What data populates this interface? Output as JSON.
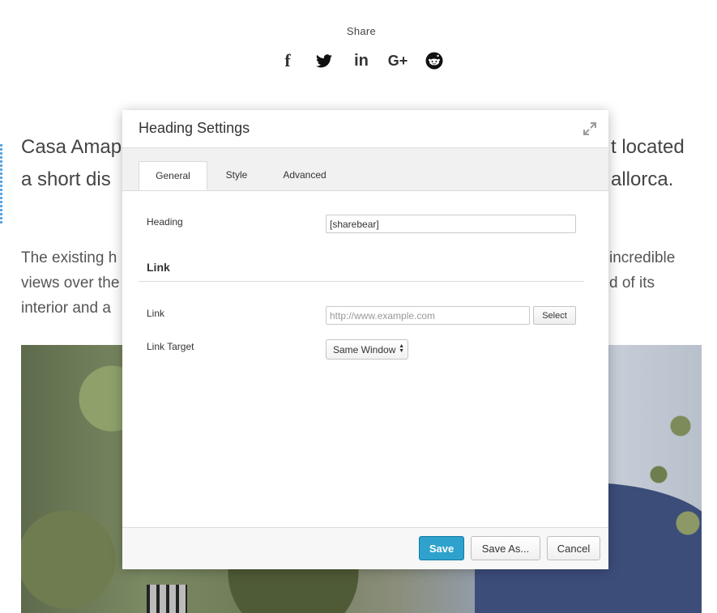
{
  "share": {
    "label": "Share",
    "icons": [
      "facebook-icon",
      "twitter-icon",
      "linkedin-icon",
      "google-plus-icon",
      "reddit-icon"
    ],
    "facebook_glyph": "f",
    "linkedin_glyph": "in",
    "googleplus_glyph": "G+"
  },
  "article": {
    "line1_left": "Casa Amap",
    "line1_right": "t located",
    "line2_left": "a short dis",
    "line2_right": "allorca.",
    "para_line1_left": "The existing h",
    "para_line1_right": "incredible",
    "para_line2_left": "views over the",
    "para_line2_right": "d of its",
    "para_line3_left": "interior and a"
  },
  "modal": {
    "title": "Heading Settings",
    "tabs": [
      {
        "label": "General",
        "active": true
      },
      {
        "label": "Style",
        "active": false
      },
      {
        "label": "Advanced",
        "active": false
      }
    ],
    "fields": {
      "heading_label": "Heading",
      "heading_value": "[sharebear]",
      "link_section_title": "Link",
      "link_label": "Link",
      "link_placeholder": "http://www.example.com",
      "select_button": "Select",
      "link_target_label": "Link Target",
      "link_target_value": "Same Window"
    },
    "footer": {
      "save": "Save",
      "save_as": "Save As...",
      "cancel": "Cancel"
    }
  },
  "colors": {
    "primary_button": "#2ea2cc",
    "tab_bar": "#f1f1f1",
    "text": "#333333"
  }
}
